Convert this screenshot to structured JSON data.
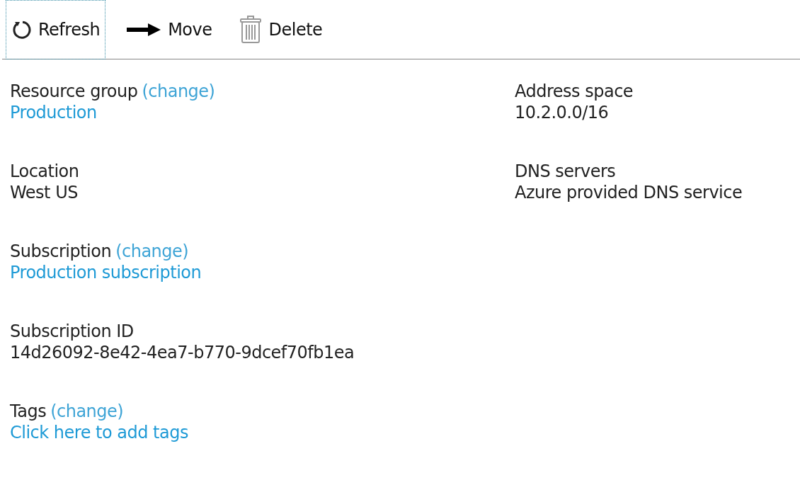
{
  "toolbar": [
    {
      "kind": "refresh",
      "label": "Refresh",
      "focused": true
    },
    {
      "kind": "move",
      "label": "Move",
      "focused": false
    },
    {
      "kind": "delete",
      "label": "Delete",
      "focused": false
    }
  ],
  "left_fields": [
    {
      "label": "Resource group",
      "change": "(change)",
      "value": "Production",
      "value_is_link": true
    },
    {
      "label": "Location",
      "value": "West US",
      "value_is_link": false
    },
    {
      "label": "Subscription",
      "change": "(change)",
      "value": "Production subscription",
      "value_is_link": true
    },
    {
      "label": "Subscription ID",
      "value": "14d26092-8e42-4ea7-b770-9dcef70fb1ea",
      "value_is_link": false
    },
    {
      "label": "Tags",
      "change": "(change)",
      "value": "Click here to add tags",
      "value_is_link": true
    }
  ],
  "right_fields": [
    {
      "label": "Address space",
      "value": "10.2.0.0/16",
      "value_is_link": false
    },
    {
      "label": "DNS servers",
      "value": "Azure provided DNS service",
      "value_is_link": false
    }
  ]
}
